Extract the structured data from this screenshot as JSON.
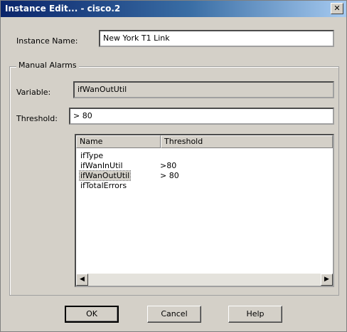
{
  "dialog": {
    "title": "Instance Edit... - cisco.2",
    "close_glyph": "✕"
  },
  "instance": {
    "label": "Instance Name:",
    "value": "New York T1 Link"
  },
  "alarms": {
    "group_title": "Manual Alarms",
    "variable_label": "Variable:",
    "variable_value": "ifWanOutUtil",
    "threshold_label": "Threshold:",
    "threshold_value": "> 80"
  },
  "list": {
    "columns": [
      "Name",
      "Threshold"
    ],
    "rows": [
      {
        "name": "ifType",
        "threshold": ""
      },
      {
        "name": "ifWanInUtil",
        "threshold": ">80"
      },
      {
        "name": "ifWanOutUtil",
        "threshold": "> 80",
        "selected": true
      },
      {
        "name": "ifTotalErrors",
        "threshold": ""
      }
    ],
    "scroll_left_glyph": "◀",
    "scroll_right_glyph": "▶"
  },
  "buttons": {
    "ok": "OK",
    "cancel": "Cancel",
    "help": "Help"
  }
}
